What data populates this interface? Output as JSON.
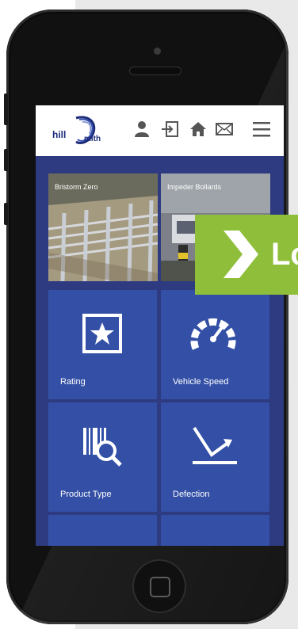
{
  "header": {
    "logo_text_1": "hill",
    "logo_text_2": "mith"
  },
  "icons": [
    "user-icon",
    "login-icon",
    "home-icon",
    "mail-icon",
    "menu-icon"
  ],
  "photo_tiles": [
    {
      "label": "Bristorm Zero"
    },
    {
      "label": "Impeder Bollards"
    }
  ],
  "tiles": [
    {
      "label": "Rating",
      "icon": "star-badge-icon"
    },
    {
      "label": "Vehicle Speed",
      "icon": "speedometer-icon"
    },
    {
      "label": "Product Type",
      "icon": "barcode-search-icon"
    },
    {
      "label": "Defection",
      "icon": "deflection-arrow-icon"
    }
  ],
  "banner": {
    "text": "Lo"
  },
  "colors": {
    "screen_bg": "#2e3b80",
    "tile_bg": "#3350a6",
    "banner_green": "#8fbf3a",
    "brand_navy": "#1c2a7a"
  }
}
